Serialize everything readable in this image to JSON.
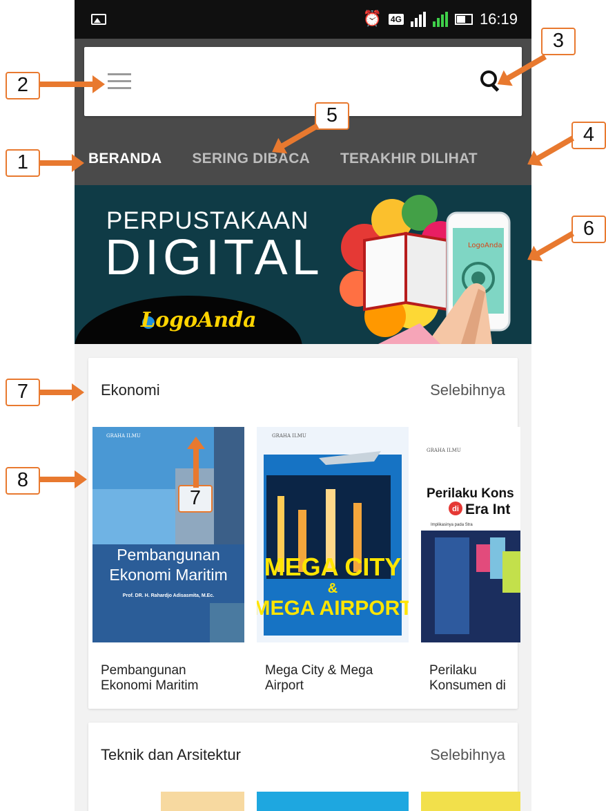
{
  "status_bar": {
    "time": "16:19",
    "network": "4G",
    "sim1": "1",
    "sim2": "2",
    "alarm_icon": "alarm-clock-icon",
    "notification_icon": "image-notification-icon",
    "battery_icon": "battery-icon"
  },
  "header": {
    "menu_icon": "hamburger-menu-icon",
    "search_icon": "search-icon",
    "tabs": [
      {
        "label": "BERANDA",
        "active": true
      },
      {
        "label": "SERING DIBACA",
        "active": false
      },
      {
        "label": "TERAKHIR DILIHAT",
        "active": false
      }
    ]
  },
  "banner": {
    "line1": "PERPUSTAKAAN",
    "line2": "DIGITAL",
    "logo": "LogoAnda",
    "phone_logo": "LogoAnda"
  },
  "sections": [
    {
      "title": "Ekonomi",
      "more": "Selebihnya",
      "books": [
        {
          "title": "Pembangunan Ekonomi Maritim",
          "cover_publisher": "GRAHA ILMU",
          "cover_title1": "Pembangunan",
          "cover_title2": "Ekonomi Maritim",
          "cover_author": "Prof. DR. H. Rahardjo Adisasmita, M.Ec."
        },
        {
          "title": "Mega City & Mega Airport",
          "cover_publisher": "GRAHA ILMU",
          "cover_title1": "MEGA CITY",
          "cover_amp": "&",
          "cover_title2": "MEGA AIRPORT"
        },
        {
          "title": "Perilaku Konsumen di Era Internet;...",
          "cover_publisher": "GRAHA ILMU",
          "cover_title1": "Perilaku Kons",
          "cover_di": "di",
          "cover_title2": "Era Int",
          "cover_sub": "Implikasinya pada Stra"
        }
      ]
    },
    {
      "title": "Teknik dan Arsitektur",
      "more": "Selebihnya"
    }
  ],
  "annotations": [
    "1",
    "2",
    "3",
    "4",
    "5",
    "6",
    "7",
    "7",
    "8"
  ],
  "colors": {
    "annotation": "#e8792f",
    "header_bg": "#4a4a4a",
    "banner_bg": "#0f3b46",
    "tab_active": "#ffffff",
    "tab_inactive": "#bdbdbd"
  }
}
